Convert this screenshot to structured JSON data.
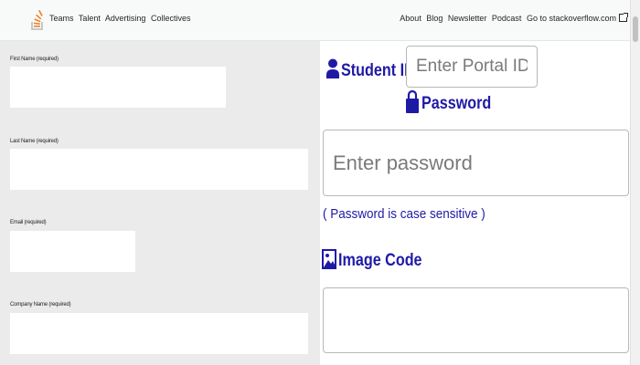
{
  "topbar": {
    "brand_items": [
      "Teams",
      "Talent",
      "Advertising",
      "Collectives"
    ],
    "links": [
      "About",
      "Blog",
      "Newsletter",
      "Podcast",
      "Go to stackoverflow.com"
    ]
  },
  "form": {
    "first_name_label": "First Name (required)",
    "last_name_label": "Last Name (required)",
    "email_label": "Email (required)",
    "company_label": "Company Name (required)"
  },
  "login": {
    "student_id_label": "Student ID",
    "portal_placeholder": "Enter Portal ID",
    "password_label": "Password",
    "password_placeholder": "Enter password",
    "hint": "( Password is case sensitive )",
    "image_code_label": "Image Code"
  },
  "colors": {
    "accent": "#1f1aa5",
    "logo_orange": "#f48024"
  }
}
